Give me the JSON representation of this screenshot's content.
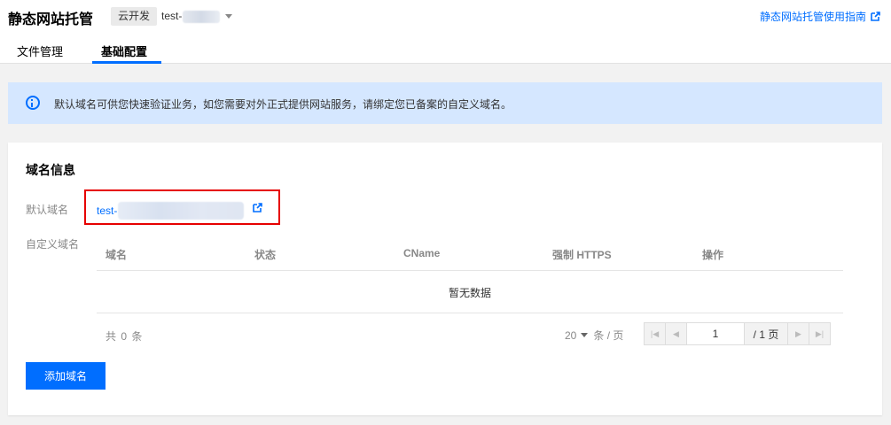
{
  "header": {
    "title": "静态网站托管",
    "env_tag": "云开发",
    "env_name": "test-",
    "guide_link": "静态网站托管使用指南"
  },
  "tabs": [
    {
      "label": "文件管理",
      "active": false
    },
    {
      "label": "基础配置",
      "active": true
    }
  ],
  "notice": {
    "text": "默认域名可供您快速验证业务，如您需要对外正式提供网站服务，请绑定您已备案的自定义域名。"
  },
  "domain_info": {
    "title": "域名信息",
    "default_label": "默认域名",
    "default_domain": "test-",
    "custom_label": "自定义域名",
    "table": {
      "columns": [
        "域名",
        "状态",
        "CName",
        "强制 HTTPS",
        "操作"
      ],
      "rows": [],
      "empty_text": "暂无数据"
    },
    "pagination": {
      "total_text": "共 0 条",
      "page_size": "20",
      "page_size_unit": "条 / 页",
      "current_page": "1",
      "total_pages": "/ 1 页"
    },
    "add_button": "添加域名"
  },
  "colors": {
    "accent": "#006eff",
    "notice_bg": "#d5e7ff",
    "highlight": "#e60000"
  }
}
